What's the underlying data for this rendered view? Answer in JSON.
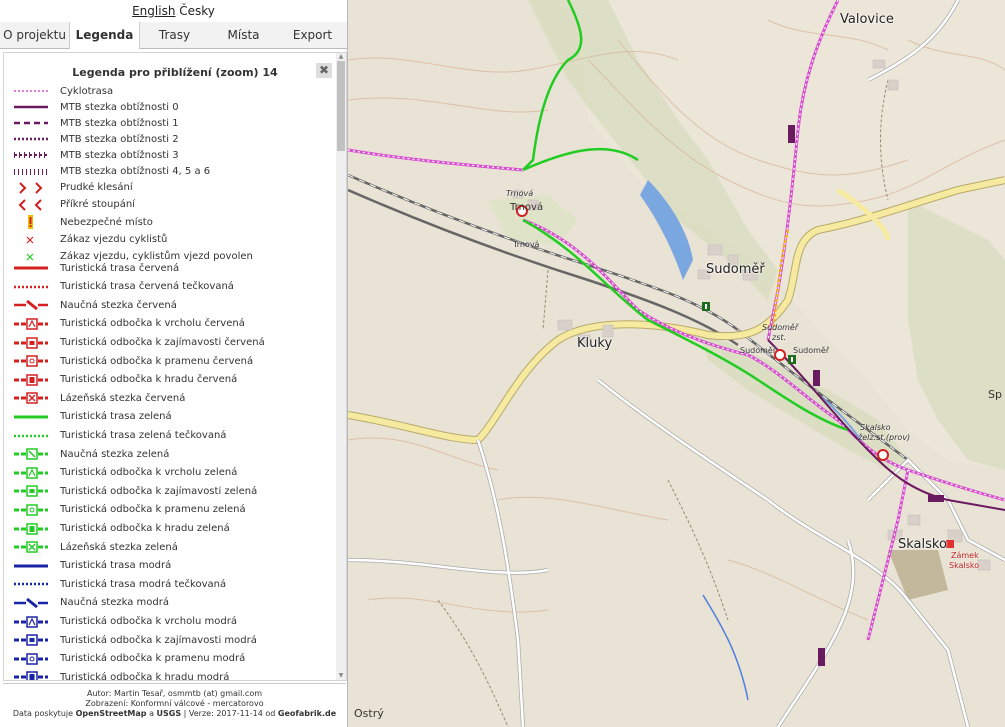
{
  "languages": {
    "english": "English",
    "czech": "Česky"
  },
  "tabs": [
    {
      "label": "O projektu",
      "active": false
    },
    {
      "label": "Legenda",
      "active": true
    },
    {
      "label": "Trasy",
      "active": false
    },
    {
      "label": "Místa",
      "active": false
    },
    {
      "label": "Export",
      "active": false
    }
  ],
  "legend": {
    "title": "Legenda pro přiblížení (zoom) 14",
    "close_label": "✖",
    "items": [
      {
        "label": "Cyklotrasa",
        "symbol": "cycle-route"
      },
      {
        "label": "MTB stezka obtížnosti 0",
        "symbol": "mtb-0"
      },
      {
        "label": "MTB stezka obtížnosti 1",
        "symbol": "mtb-1"
      },
      {
        "label": "MTB stezka obtížnosti 2",
        "symbol": "mtb-2"
      },
      {
        "label": "MTB stezka obtížnosti 3",
        "symbol": "mtb-3"
      },
      {
        "label": "MTB stezka obtížnosti 4, 5 a 6",
        "symbol": "mtb-4"
      },
      {
        "label": "Prudké klesání",
        "symbol": "steep-descent"
      },
      {
        "label": "Příkré stoupání",
        "symbol": "steep-climb"
      },
      {
        "label": "Nebezpečné místo",
        "symbol": "danger"
      },
      {
        "label": "Zákaz vjezdu cyklistů",
        "symbol": "no-bikes"
      },
      {
        "label": "Zákaz vjezdu, cyklistům vjezd povolen",
        "symbol": "bikes-allowed"
      },
      {
        "label": "Turistická trasa červená",
        "symbol": "trail-solid"
      },
      {
        "label": "Turistická trasa červená tečkovaná",
        "symbol": "trail-dotted"
      },
      {
        "label": "Naučná stezka červená",
        "symbol": "trail-nature"
      },
      {
        "label": "Turistická odbočka k vrcholu červená",
        "symbol": "trail-peak"
      },
      {
        "label": "Turistická odbočka k zajímavosti červená",
        "symbol": "trail-sight"
      },
      {
        "label": "Turistická odbočka k pramenu červená",
        "symbol": "trail-spring"
      },
      {
        "label": "Turistická odbočka k hradu červená",
        "symbol": "trail-castle"
      },
      {
        "label": "Lázeňská stezka červená",
        "symbol": "trail-spa"
      },
      {
        "label": "Turistická trasa zelená",
        "symbol": "trail-solid"
      },
      {
        "label": "Turistická trasa zelená tečkovaná",
        "symbol": "trail-dotted"
      },
      {
        "label": "Naučná stezka zelená",
        "symbol": "trail-nature-box"
      },
      {
        "label": "Turistická odbočka k vrcholu zelená",
        "symbol": "trail-peak"
      },
      {
        "label": "Turistická odbočka k zajímavosti zelená",
        "symbol": "trail-sight"
      },
      {
        "label": "Turistická odbočka k pramenu zelená",
        "symbol": "trail-spring"
      },
      {
        "label": "Turistická odbočka k hradu zelená",
        "symbol": "trail-castle"
      },
      {
        "label": "Lázeňská stezka zelená",
        "symbol": "trail-spa"
      },
      {
        "label": "Turistická trasa modrá",
        "symbol": "trail-solid"
      },
      {
        "label": "Turistická trasa modrá tečkovaná",
        "symbol": "trail-dotted"
      },
      {
        "label": "Naučná stezka modrá",
        "symbol": "trail-nature"
      },
      {
        "label": "Turistická odbočka k vrcholu modrá",
        "symbol": "trail-peak"
      },
      {
        "label": "Turistická odbočka k zajímavosti modrá",
        "symbol": "trail-sight"
      },
      {
        "label": "Turistická odbočka k pramenu modrá",
        "symbol": "trail-spring"
      },
      {
        "label": "Turistická odbočka k hradu modrá",
        "symbol": "trail-castle"
      }
    ]
  },
  "colors": {
    "cycle": "#d94fd1",
    "mtb": "#6a1a5e",
    "red": "#d42020",
    "green": "#22cc22",
    "blue": "#1a24a6",
    "danger": "#f0c000",
    "road_yellow": "#f5eaa0",
    "water": "#7ba7e0",
    "forest": "#d9dcc2"
  },
  "footer": {
    "author": "Autor: Martin Tesař, osmmtb (at) gmail.com",
    "projection": "Zobrazení: Konformní válcové - mercatorovo",
    "data_prefix": "Data poskytuje",
    "osm": "OpenStreetMap",
    "and_text": "a",
    "usgs": "USGS",
    "version": "| Verze: 2017-11-14 od",
    "geofabrik": "Geofabrik.de"
  },
  "map": {
    "labels": {
      "valovice": "Valovice",
      "trnova_1": "Trnová",
      "trnova_2": "Trnová",
      "trnova_small": "Trnová",
      "sudomer": "Sudoměř",
      "kluky": "Kluky",
      "sudomer_zst": "Sudoměř",
      "zst": "zst.",
      "sudomer_stop": "Sudoměř",
      "sudomer_stop2": "Sudoměř",
      "skalsko_zst": "Skalsko",
      "skalsko_zst2": "želz.st.(prov)",
      "skalsko": "Skalsko",
      "zamek": "Zámek",
      "zamek2": "Skalsko",
      "ostry": "Ostrý",
      "sp": "Sp"
    }
  }
}
